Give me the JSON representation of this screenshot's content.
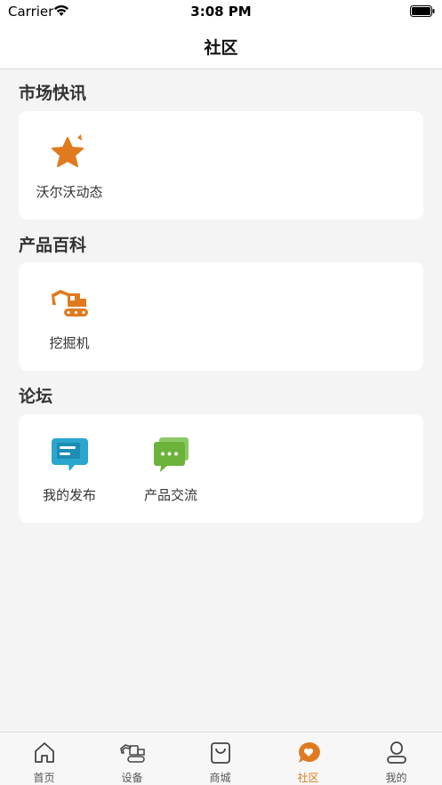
{
  "status_bar": {
    "carrier": "Carrier",
    "time": "3:08 PM"
  },
  "nav": {
    "title": "社区"
  },
  "sections": [
    {
      "title": "市场快讯",
      "items": [
        {
          "label": "沃尔沃动态",
          "icon": "star-icon"
        }
      ]
    },
    {
      "title": "产品百科",
      "items": [
        {
          "label": "挖掘机",
          "icon": "excavator-icon"
        }
      ]
    },
    {
      "title": "论坛",
      "items": [
        {
          "label": "我的发布",
          "icon": "my-posts-icon"
        },
        {
          "label": "产品交流",
          "icon": "chat-bubbles-icon"
        }
      ]
    }
  ],
  "tabs": [
    {
      "label": "首页",
      "icon": "home-icon"
    },
    {
      "label": "设备",
      "icon": "equipment-icon"
    },
    {
      "label": "商城",
      "icon": "shopping-bag-icon"
    },
    {
      "label": "社区",
      "icon": "community-icon",
      "active": true
    },
    {
      "label": "我的",
      "icon": "profile-icon"
    }
  ],
  "colors": {
    "accent": "#e07a1f",
    "forum_blue": "#2aa6cf",
    "forum_green": "#6bb33a"
  }
}
